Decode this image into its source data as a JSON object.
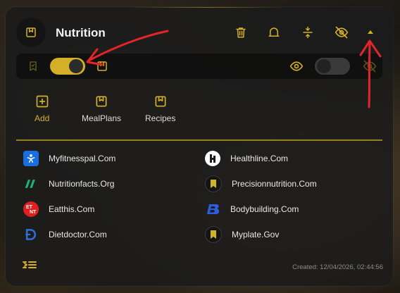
{
  "header": {
    "title": "Nutrition",
    "icons": [
      "bookmark-icon",
      "trash-icon",
      "bell-icon",
      "compress-icon",
      "eye-off-icon",
      "caret-up-icon"
    ]
  },
  "toolbar": {
    "left_icon": "bookmark-check-icon",
    "toggle_left_state": "on",
    "middle_icon": "bookmark-icon",
    "eye_icon": "eye-icon",
    "toggle_right_state": "off",
    "right_icon": "eye-off-icon"
  },
  "actions": [
    {
      "label": "Add",
      "icon": "plus-square-icon"
    },
    {
      "label": "MealPlans",
      "icon": "bookmark-icon"
    },
    {
      "label": "Recipes",
      "icon": "bookmark-icon"
    }
  ],
  "links": {
    "left": [
      {
        "name": "Myfitnesspal.Com",
        "icon": "myfitnesspal-icon"
      },
      {
        "name": "Nutritionfacts.Org",
        "icon": "nutritionfacts-icon"
      },
      {
        "name": "Eatthis.Com",
        "icon": "eatthis-icon"
      },
      {
        "name": "Dietdoctor.Com",
        "icon": "dietdoctor-icon"
      }
    ],
    "right": [
      {
        "name": "Healthline.Com",
        "icon": "healthline-icon"
      },
      {
        "name": "Precisionnutrition.Com",
        "icon": "bookmark-icon"
      },
      {
        "name": "Bodybuilding.Com",
        "icon": "bodybuilding-icon"
      },
      {
        "name": "Myplate.Gov",
        "icon": "bookmark-icon"
      }
    ]
  },
  "footer": {
    "icon": "indent-list-icon",
    "created": "Created: 12/04/2026, 02:44:56"
  },
  "colors": {
    "accent": "#d4b028",
    "panel": "#1c1c1c",
    "text": "#e8e8e8",
    "muted": "#8c8c8c"
  }
}
